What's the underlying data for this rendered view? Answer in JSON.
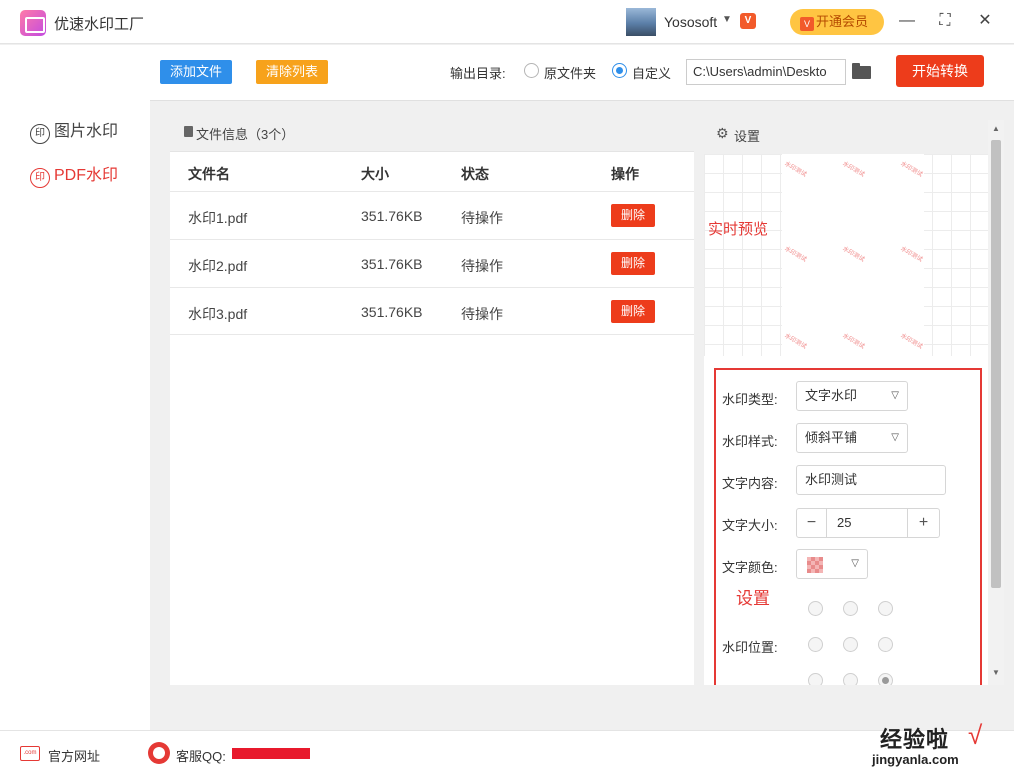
{
  "app": {
    "title": "优速水印工厂"
  },
  "user": {
    "name": "Yososoft",
    "vip_button": "开通会员"
  },
  "sidebar": {
    "items": [
      {
        "label": "图片水印",
        "icon_char": "印"
      },
      {
        "label": "PDF水印",
        "icon_char": "印"
      }
    ]
  },
  "toolbar": {
    "add_label": "添加文件",
    "clear_label": "清除列表",
    "output_label": "输出目录:",
    "option_original": "原文件夹",
    "option_custom": "自定义",
    "path_value": "C:\\Users\\admin\\Deskto",
    "start_label": "开始转换"
  },
  "files": {
    "header": "文件信息（3个）",
    "columns": [
      "文件名",
      "大小",
      "状态",
      "操作"
    ],
    "rows": [
      {
        "name": "水印1.pdf",
        "size": "351.76KB",
        "status": "待操作",
        "action": "删除"
      },
      {
        "name": "水印2.pdf",
        "size": "351.76KB",
        "status": "待操作",
        "action": "删除"
      },
      {
        "name": "水印3.pdf",
        "size": "351.76KB",
        "status": "待操作",
        "action": "删除"
      }
    ]
  },
  "settings": {
    "header": "设置",
    "preview_label": "实时预览",
    "preview_watermark": "水印测试",
    "type_label": "水印类型:",
    "type_value": "文字水印",
    "style_label": "水印样式:",
    "style_value": "倾斜平铺",
    "content_label": "文字内容:",
    "content_value": "水印测试",
    "size_label": "文字大小:",
    "size_value": "25",
    "color_label": "文字颜色:",
    "note": "设置",
    "position_label": "水印位置:"
  },
  "footer": {
    "site": "官方网址",
    "qq": "客服QQ:"
  },
  "overlay": {
    "stamp": "经验啦",
    "url": "jingyanla.com"
  },
  "colors": {
    "accent_red": "#ed3c1b",
    "blue": "#2f8fea",
    "orange": "#f7a21b",
    "vip_yellow": "#ffc542"
  }
}
